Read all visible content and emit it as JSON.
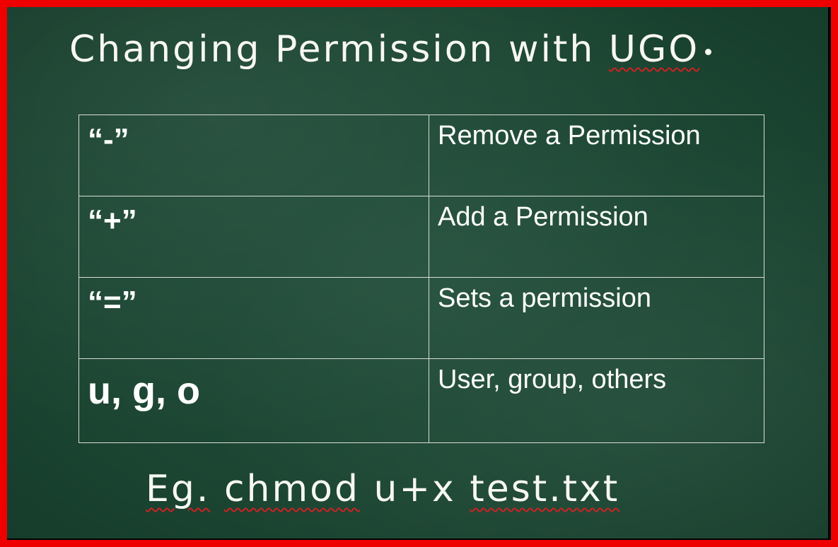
{
  "slide": {
    "title_main": "Changing Permission with ",
    "title_highlight": "UGO",
    "table": {
      "rows": [
        {
          "symbol": "“-”",
          "description": "Remove a Permission"
        },
        {
          "symbol": "“+”",
          "description": "Add a Permission"
        },
        {
          "symbol": "“=”",
          "description": "Sets a permission"
        },
        {
          "symbol": "u, g, o",
          "description": "User, group, others"
        }
      ]
    },
    "example": {
      "prefix": "Eg.",
      "command": "chmod",
      "arg": "u+x",
      "file": "test.txt"
    }
  },
  "colors": {
    "frame": "#ee0000",
    "board": "#1c4633",
    "chalk": "#f7f7f2",
    "spellcheck_underline": "#cc2222"
  }
}
